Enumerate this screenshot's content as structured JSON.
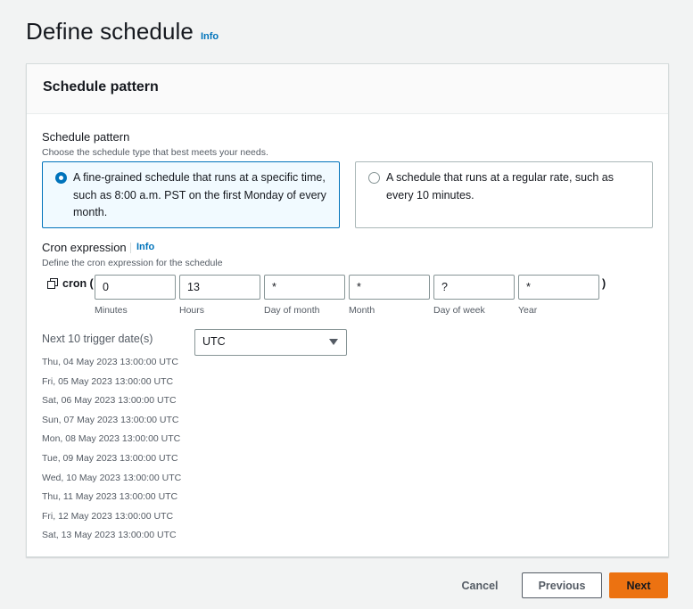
{
  "page": {
    "title": "Define schedule",
    "info": "Info"
  },
  "card": {
    "title": "Schedule pattern",
    "pattern": {
      "label": "Schedule pattern",
      "description": "Choose the schedule type that best meets your needs.",
      "options": [
        {
          "text": "A fine-grained schedule that runs at a specific time, such as 8:00 a.m. PST on the first Monday of every month.",
          "selected": true
        },
        {
          "text": "A schedule that runs at a regular rate, such as every 10 minutes.",
          "selected": false
        }
      ]
    },
    "cron": {
      "label": "Cron expression",
      "info": "Info",
      "description": "Define the cron expression for the schedule",
      "prefix": "cron (",
      "suffix": ")",
      "fields": [
        {
          "value": "0",
          "sublabel": "Minutes"
        },
        {
          "value": "13",
          "sublabel": "Hours"
        },
        {
          "value": "*",
          "sublabel": "Day of month"
        },
        {
          "value": "*",
          "sublabel": "Month"
        },
        {
          "value": "?",
          "sublabel": "Day of week"
        },
        {
          "value": "*",
          "sublabel": "Year"
        }
      ]
    },
    "trigger": {
      "label": "Next 10 trigger date(s)",
      "timezone": "UTC",
      "dates": [
        "Thu, 04 May 2023 13:00:00 UTC",
        "Fri, 05 May 2023 13:00:00 UTC",
        "Sat, 06 May 2023 13:00:00 UTC",
        "Sun, 07 May 2023 13:00:00 UTC",
        "Mon, 08 May 2023 13:00:00 UTC",
        "Tue, 09 May 2023 13:00:00 UTC",
        "Wed, 10 May 2023 13:00:00 UTC",
        "Thu, 11 May 2023 13:00:00 UTC",
        "Fri, 12 May 2023 13:00:00 UTC",
        "Sat, 13 May 2023 13:00:00 UTC"
      ]
    }
  },
  "footer": {
    "cancel": "Cancel",
    "previous": "Previous",
    "next": "Next"
  },
  "colors": {
    "accent": "#0073bb",
    "primary_button": "#ec7211"
  }
}
